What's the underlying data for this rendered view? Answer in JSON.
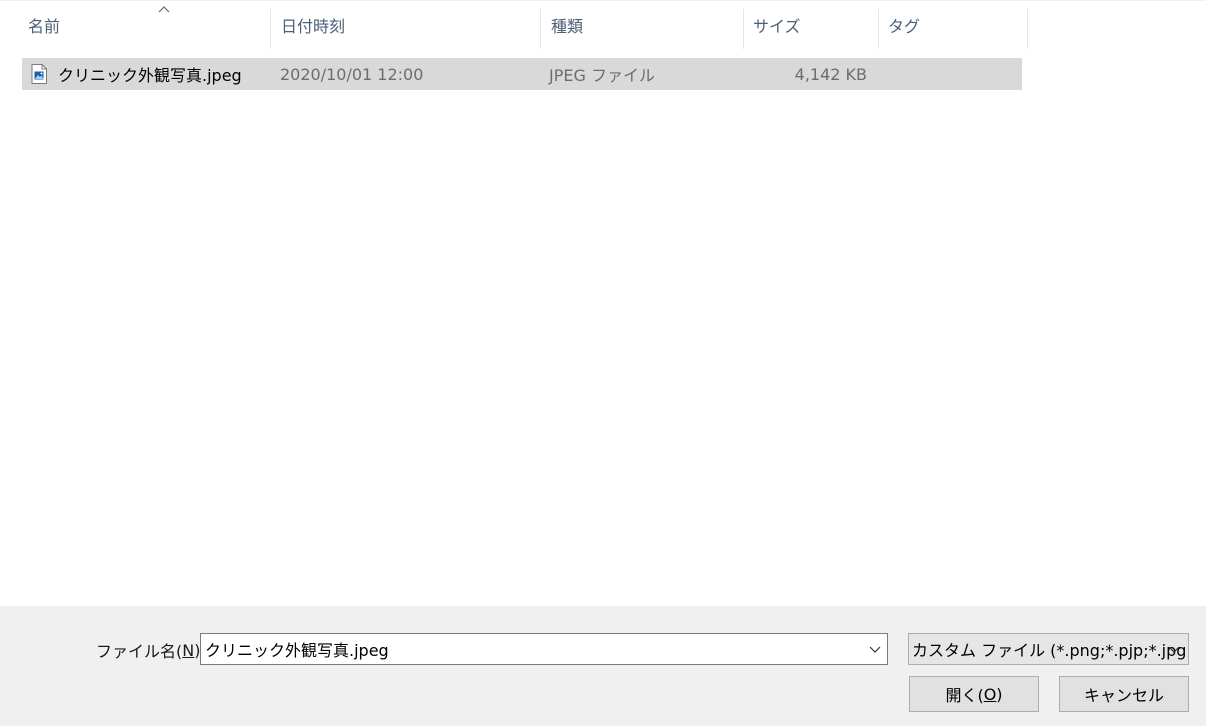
{
  "columns": {
    "name": "名前",
    "date": "日付時刻",
    "type": "種類",
    "size": "サイズ",
    "tags": "タグ"
  },
  "files": [
    {
      "name": "クリニック外観写真.jpeg",
      "date": "2020/10/01 12:00",
      "type": "JPEG ファイル",
      "size": "4,142 KB",
      "icon": "image-file-icon",
      "selected": true
    }
  ],
  "footer": {
    "filename_label_prefix": "ファイル名(",
    "filename_label_key": "N",
    "filename_label_suffix": "):",
    "filename_value": "クリニック外観写真.jpeg",
    "filetype_selected": "カスタム ファイル (*.png;*.pjp;*.jpg",
    "open_label_prefix": "開く(",
    "open_label_key": "O",
    "open_label_suffix": ")",
    "cancel_label": "キャンセル"
  },
  "colors": {
    "header_text": "#4c607a",
    "selected_row": "#d9d9d9",
    "footer_bg": "#f0f0f0"
  }
}
